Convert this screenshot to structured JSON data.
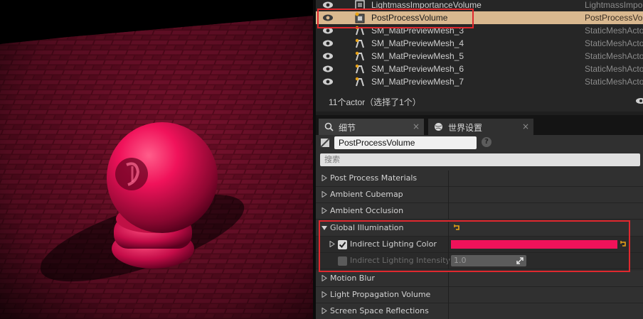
{
  "outliner": {
    "rows": [
      {
        "name": "LightmassImportanceVolume",
        "type": "LightmassImpo",
        "icon": "volume-icon",
        "selected": false
      },
      {
        "name": "PostProcessVolume",
        "type": "PostProcessVo",
        "icon": "post-process-volume-icon",
        "selected": true
      },
      {
        "name": "SM_MatPreviewMesh_3",
        "type": "StaticMeshActo",
        "icon": "static-mesh-icon",
        "selected": false
      },
      {
        "name": "SM_MatPreviewMesh_4",
        "type": "StaticMeshActo",
        "icon": "static-mesh-icon",
        "selected": false
      },
      {
        "name": "SM_MatPreviewMesh_5",
        "type": "StaticMeshActo",
        "icon": "static-mesh-icon",
        "selected": false
      },
      {
        "name": "SM_MatPreviewMesh_6",
        "type": "StaticMeshActo",
        "icon": "static-mesh-icon",
        "selected": false
      },
      {
        "name": "SM_MatPreviewMesh_7",
        "type": "StaticMeshActo",
        "icon": "static-mesh-icon",
        "selected": false
      }
    ],
    "status": "11个actor（选择了1个）"
  },
  "tabs": [
    {
      "label": "细节",
      "icon": "search-icon",
      "close": "×",
      "active": true
    },
    {
      "label": "世界设置",
      "icon": "globe-icon",
      "close": "×",
      "active": false
    }
  ],
  "details": {
    "actor_name": "PostProcessVolume",
    "help": "?",
    "search_placeholder": "搜索"
  },
  "properties": [
    {
      "label": "Post Process Materials",
      "kind": "category",
      "expanded": false
    },
    {
      "label": "Ambient Cubemap",
      "kind": "category",
      "expanded": false
    },
    {
      "label": "Ambient Occlusion",
      "kind": "category",
      "expanded": false
    },
    {
      "label": "Global Illumination",
      "kind": "category",
      "expanded": true
    },
    {
      "label": "Indirect Lighting Color",
      "kind": "color",
      "checked": true,
      "value": "#f0125a"
    },
    {
      "label": "Indirect Lighting Intensity",
      "kind": "number",
      "checked": false,
      "value": "1.0"
    },
    {
      "label": "Motion Blur",
      "kind": "category",
      "expanded": false
    },
    {
      "label": "Light Propagation Volume",
      "kind": "category",
      "expanded": false
    },
    {
      "label": "Screen Space Reflections",
      "kind": "category",
      "expanded": false
    }
  ],
  "colors": {
    "accent_red": "#e0282e",
    "selection": "#d9b88f",
    "indirect_lighting_color": "#f0125a",
    "reset_arrow": "#e8a317"
  }
}
